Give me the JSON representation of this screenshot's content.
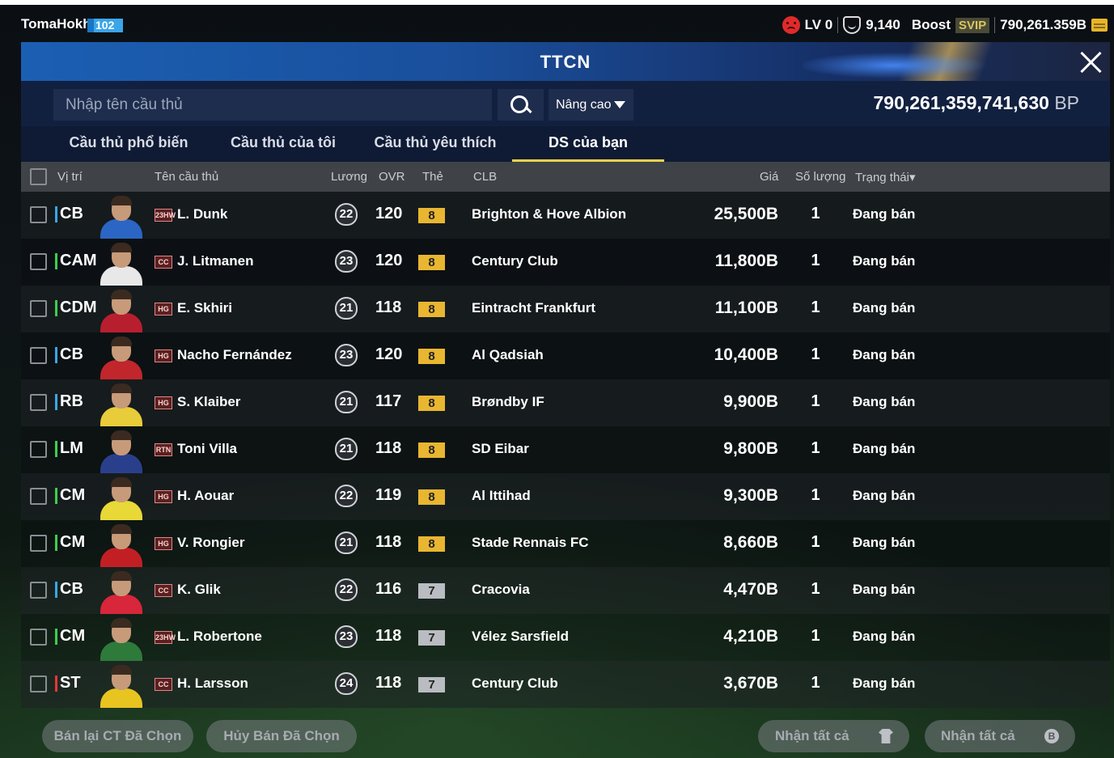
{
  "topbar": {
    "username": "TomaHokh",
    "level": "102",
    "lv_label": "LV 0",
    "shield_value": "9,140",
    "boost_label": "Boost",
    "svip_label": "SVIP",
    "coins": "790,261.359B"
  },
  "panel": {
    "title": "TTCN",
    "search_placeholder": "Nhập tên cầu thủ",
    "advanced_label": "Nâng cao",
    "bp_value": "790,261,359,741,630",
    "bp_unit": "BP"
  },
  "tabs": [
    {
      "label": "Cầu thủ phổ biến",
      "active": false
    },
    {
      "label": "Cầu thủ của tôi",
      "active": false
    },
    {
      "label": "Cầu thủ yêu thích",
      "active": false
    },
    {
      "label": "DS của bạn",
      "active": true
    }
  ],
  "table": {
    "headers": {
      "position": "Vị trí",
      "name": "Tên cầu thủ",
      "salary": "Lương",
      "ovr": "OVR",
      "card": "Thẻ",
      "club": "CLB",
      "price": "Giá",
      "qty": "Số lượng",
      "status": "Trạng thái▾"
    },
    "rows": [
      {
        "pos": "CB",
        "pos_color": "#3aa6e8",
        "season": "23HW",
        "name": "L. Dunk",
        "salary": "22",
        "ovr": "120",
        "upgrade": "8",
        "upgrade_color": "#e8b630",
        "club": "Brighton & Hove Albion",
        "price": "25,500B",
        "qty": "1",
        "status": "Đang bán",
        "kit": "#2b66c4"
      },
      {
        "pos": "CAM",
        "pos_color": "#3ccf4e",
        "season": "CC",
        "name": "J. Litmanen",
        "salary": "23",
        "ovr": "120",
        "upgrade": "8",
        "upgrade_color": "#e8b630",
        "club": "Century Club",
        "price": "11,800B",
        "qty": "1",
        "status": "Đang bán",
        "kit": "#e8e8e8"
      },
      {
        "pos": "CDM",
        "pos_color": "#3ccf4e",
        "season": "HG",
        "name": "E. Skhiri",
        "salary": "21",
        "ovr": "118",
        "upgrade": "8",
        "upgrade_color": "#e8b630",
        "club": "Eintracht Frankfurt",
        "price": "11,100B",
        "qty": "1",
        "status": "Đang bán",
        "kit": "#b81f2e"
      },
      {
        "pos": "CB",
        "pos_color": "#3aa6e8",
        "season": "HG",
        "name": "Nacho Fernández",
        "salary": "23",
        "ovr": "120",
        "upgrade": "8",
        "upgrade_color": "#e8b630",
        "club": "Al Qadsiah",
        "price": "10,400B",
        "qty": "1",
        "status": "Đang bán",
        "kit": "#c0262c"
      },
      {
        "pos": "RB",
        "pos_color": "#3aa6e8",
        "season": "HG",
        "name": "S. Klaiber",
        "salary": "21",
        "ovr": "117",
        "upgrade": "8",
        "upgrade_color": "#e8b630",
        "club": "Brøndby IF",
        "price": "9,900B",
        "qty": "1",
        "status": "Đang bán",
        "kit": "#e8cc3a"
      },
      {
        "pos": "LM",
        "pos_color": "#3ccf4e",
        "season": "RTN",
        "name": "Toni Villa",
        "salary": "21",
        "ovr": "118",
        "upgrade": "8",
        "upgrade_color": "#e8b630",
        "club": "SD Eibar",
        "price": "9,800B",
        "qty": "1",
        "status": "Đang bán",
        "kit": "#2a3f8c"
      },
      {
        "pos": "CM",
        "pos_color": "#3ccf4e",
        "season": "HG",
        "name": "H. Aouar",
        "salary": "22",
        "ovr": "119",
        "upgrade": "8",
        "upgrade_color": "#e8b630",
        "club": "Al Ittihad",
        "price": "9,300B",
        "qty": "1",
        "status": "Đang bán",
        "kit": "#e8d838"
      },
      {
        "pos": "CM",
        "pos_color": "#3ccf4e",
        "season": "HG",
        "name": "V. Rongier",
        "salary": "21",
        "ovr": "118",
        "upgrade": "8",
        "upgrade_color": "#e8b630",
        "club": "Stade Rennais FC",
        "price": "8,660B",
        "qty": "1",
        "status": "Đang bán",
        "kit": "#c21f24"
      },
      {
        "pos": "CB",
        "pos_color": "#3aa6e8",
        "season": "CC",
        "name": "K. Glik",
        "salary": "22",
        "ovr": "116",
        "upgrade": "7",
        "upgrade_color": "#b9bcc1",
        "club": "Cracovia",
        "price": "4,470B",
        "qty": "1",
        "status": "Đang bán",
        "kit": "#d8263a"
      },
      {
        "pos": "CM",
        "pos_color": "#3ccf4e",
        "season": "23HW",
        "name": "L. Robertone",
        "salary": "23",
        "ovr": "118",
        "upgrade": "7",
        "upgrade_color": "#b9bcc1",
        "club": "Vélez Sarsfield",
        "price": "4,210B",
        "qty": "1",
        "status": "Đang bán",
        "kit": "#2e7a3a"
      },
      {
        "pos": "ST",
        "pos_color": "#e8363a",
        "season": "CC",
        "name": "H. Larsson",
        "salary": "24",
        "ovr": "118",
        "upgrade": "7",
        "upgrade_color": "#b9bcc1",
        "club": "Century Club",
        "price": "3,670B",
        "qty": "1",
        "status": "Đang bán",
        "kit": "#e8c420"
      }
    ]
  },
  "bottom": {
    "resell_label": "Bán lại CT Đã Chọn",
    "cancel_label": "Hủy Bán Đã Chọn",
    "claim_all_1": "Nhận tất cả",
    "claim_all_2": "Nhận tất cả"
  }
}
